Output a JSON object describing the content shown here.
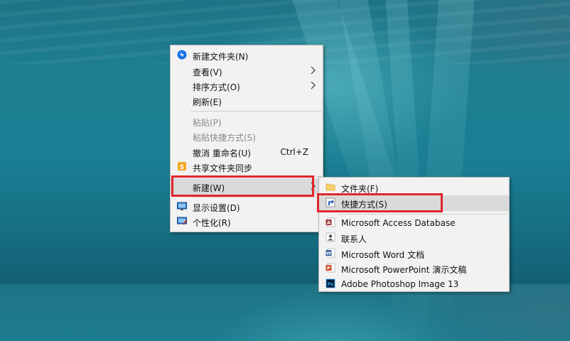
{
  "main_menu": {
    "items": [
      {
        "label": "新建文件夹(N)",
        "icon": "new-folder-icon"
      },
      {
        "label": "查看(V)"
      },
      {
        "label": "排序方式(O)"
      },
      {
        "label": "刷新(E)"
      },
      {
        "label": "粘贴(P)"
      },
      {
        "label": "粘贴快捷方式(S)"
      },
      {
        "label": "撤消 重命名(U)",
        "shortcut": "Ctrl+Z"
      },
      {
        "label": "共享文件夹同步",
        "icon": "sync-folder-icon"
      },
      {
        "label": "新建(W)"
      },
      {
        "label": "显示设置(D)",
        "icon": "display-settings-icon"
      },
      {
        "label": "个性化(R)",
        "icon": "personalize-icon"
      }
    ]
  },
  "sub_menu": {
    "items": [
      {
        "label": "文件夹(F)",
        "icon": "folder-icon"
      },
      {
        "label": "快捷方式(S)",
        "icon": "shortcut-icon"
      },
      {
        "label": "Microsoft Access Database",
        "icon": "access-icon"
      },
      {
        "label": "联系人",
        "icon": "contact-icon"
      },
      {
        "label": "Microsoft Word 文档",
        "icon": "word-icon"
      },
      {
        "label": "Microsoft PowerPoint 演示文稿",
        "icon": "powerpoint-icon"
      },
      {
        "label": "Adobe Photoshop Image 13",
        "icon": "photoshop-icon"
      }
    ]
  },
  "colors": {
    "highlight_box": "#e0262b",
    "menu_bg": "#f2f2f2",
    "desktop": "#1a7f93"
  }
}
